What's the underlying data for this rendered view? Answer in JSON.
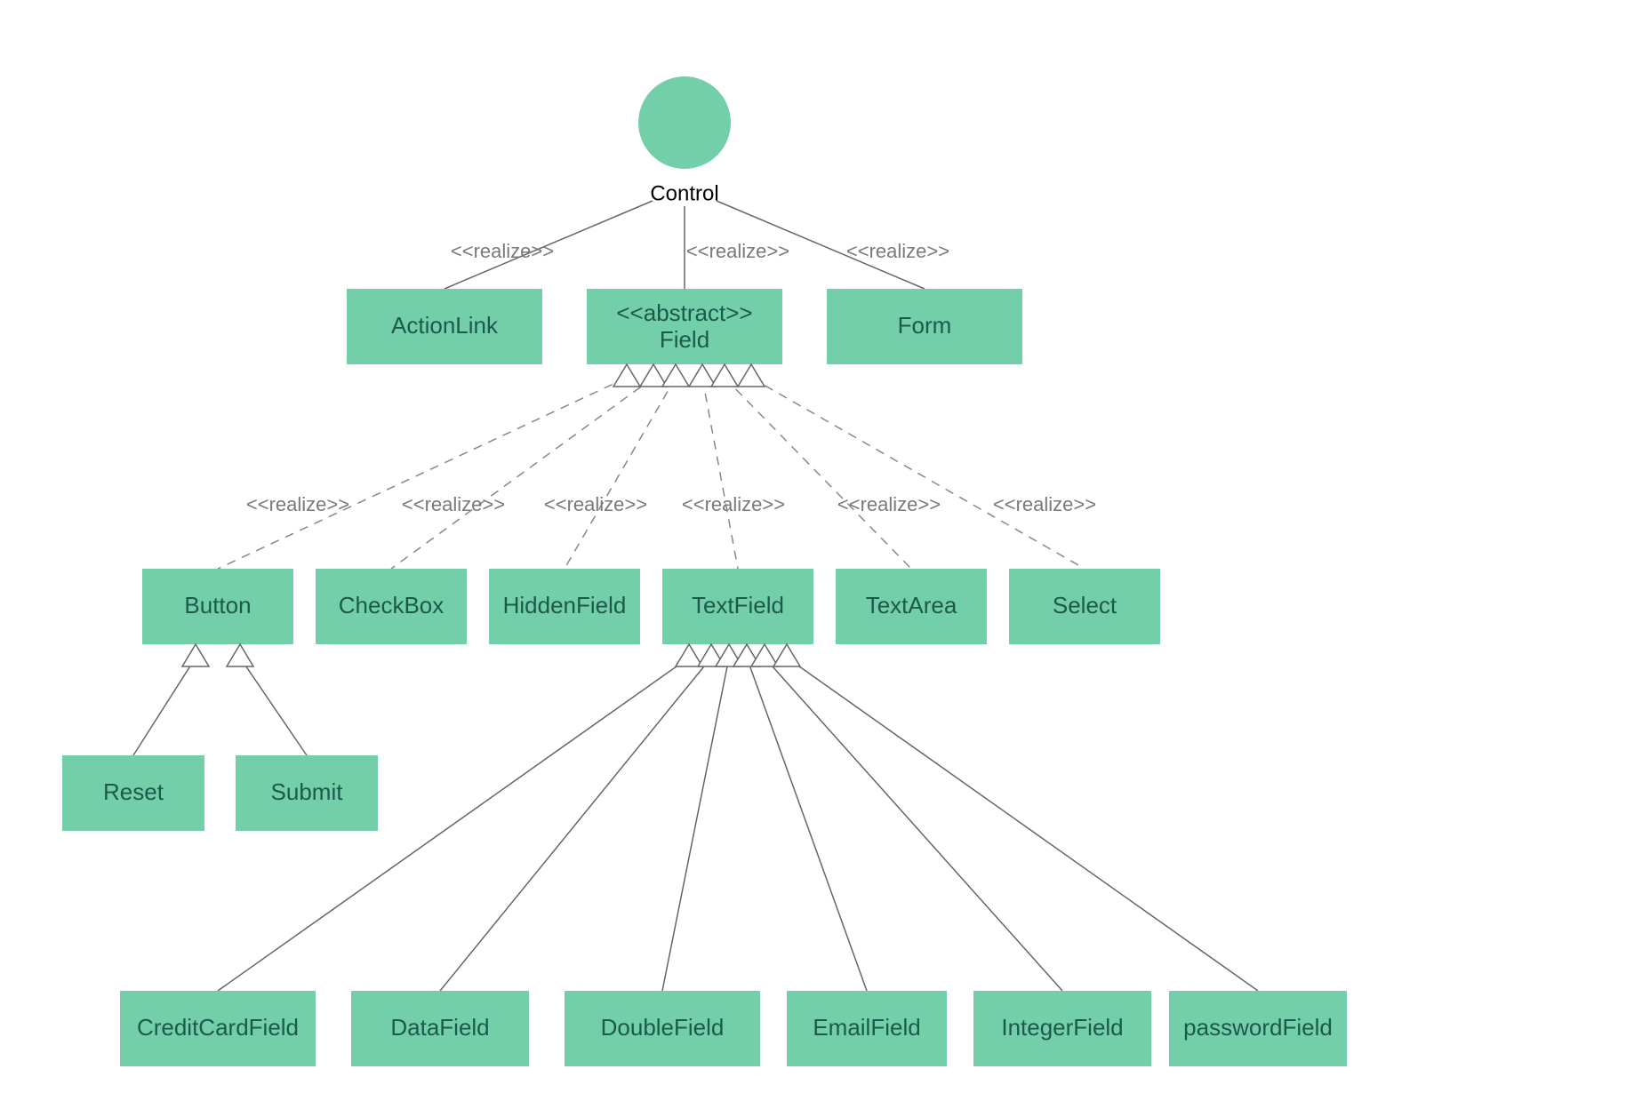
{
  "colors": {
    "node": "#73cfaa",
    "text": "#1b5a4a",
    "edgeText": "#7a7a7a"
  },
  "root": {
    "label": "Control"
  },
  "realizeLabel": "<<realize>>",
  "level1": {
    "actionLink": {
      "label": "ActionLink"
    },
    "field": {
      "stereotype": "<<abstract>>",
      "label": "Field"
    },
    "form": {
      "label": "Form"
    }
  },
  "level2": {
    "button": {
      "label": "Button"
    },
    "checkbox": {
      "label": "CheckBox"
    },
    "hiddenField": {
      "label": "HiddenField"
    },
    "textField": {
      "label": "TextField"
    },
    "textArea": {
      "label": "TextArea"
    },
    "select": {
      "label": "Select"
    }
  },
  "buttonChildren": {
    "reset": {
      "label": "Reset"
    },
    "submit": {
      "label": "Submit"
    }
  },
  "textFieldChildren": {
    "creditCardField": {
      "label": "CreditCardField"
    },
    "dataField": {
      "label": "DataField"
    },
    "doubleField": {
      "label": "DoubleField"
    },
    "emailField": {
      "label": "EmailField"
    },
    "integerField": {
      "label": "IntegerField"
    },
    "passwordField": {
      "label": "passwordField"
    }
  }
}
